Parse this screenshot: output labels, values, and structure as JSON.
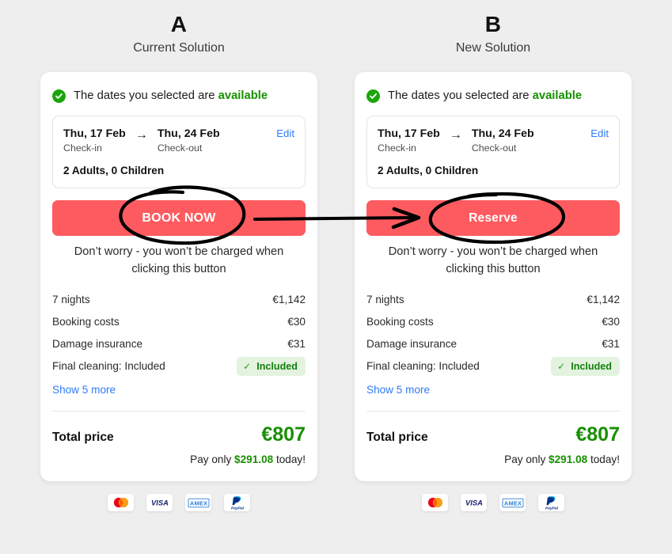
{
  "background_color": "#efeeee",
  "accent_colors": {
    "cta_red": "#fe5b60",
    "success_green": "#179000",
    "check_circle_green": "#1aa50b",
    "link_blue": "#2f7bf6",
    "badge_bg": "#e3f3df",
    "card_white": "#ffffff"
  },
  "panels": [
    {
      "letter": "A",
      "subtitle": "Current Solution",
      "availability": {
        "icon": "check-circle-icon",
        "text_prefix": "The dates you selected are ",
        "text_highlight": "available"
      },
      "dates": {
        "checkin_date": "Thu, 17 Feb",
        "checkin_label": "Check-in",
        "arrow": "→",
        "checkout_date": "Thu, 24 Feb",
        "checkout_label": "Check-out",
        "edit_label": "Edit",
        "guests": "2 Adults, 0 Children"
      },
      "cta_label": "BOOK NOW",
      "reassurance": "Don’t worry - you won’t be charged when clicking this button",
      "price_rows": [
        {
          "label": "7 nights",
          "value": "€1,142",
          "badge": null
        },
        {
          "label": "Booking costs",
          "value": "€30",
          "badge": null
        },
        {
          "label": "Damage insurance",
          "value": "€31",
          "badge": null
        },
        {
          "label": "Final cleaning: Included",
          "value": "",
          "badge": "Included"
        }
      ],
      "show_more_label": "Show 5 more",
      "total_label": "Total price",
      "total_value": "€807",
      "paynow_prefix": "Pay only ",
      "paynow_amount": "$291.08",
      "paynow_suffix": " today!",
      "payment_methods": [
        "mastercard-icon",
        "visa-icon",
        "amex-icon",
        "paypal-icon"
      ]
    },
    {
      "letter": "B",
      "subtitle": "New Solution",
      "availability": {
        "icon": "check-circle-icon",
        "text_prefix": "The dates you selected are ",
        "text_highlight": "available"
      },
      "dates": {
        "checkin_date": "Thu, 17 Feb",
        "checkin_label": "Check-in",
        "arrow": "→",
        "checkout_date": "Thu, 24 Feb",
        "checkout_label": "Check-out",
        "edit_label": "Edit",
        "guests": "2 Adults, 0 Children"
      },
      "cta_label": "Reserve",
      "reassurance": "Don’t worry - you won’t be charged when clicking this button",
      "price_rows": [
        {
          "label": "7 nights",
          "value": "€1,142",
          "badge": null
        },
        {
          "label": "Booking costs",
          "value": "€30",
          "badge": null
        },
        {
          "label": "Damage insurance",
          "value": "€31",
          "badge": null
        },
        {
          "label": "Final cleaning: Included",
          "value": "",
          "badge": "Included"
        }
      ],
      "show_more_label": "Show 5 more",
      "total_label": "Total price",
      "total_value": "€807",
      "paynow_prefix": "Pay only ",
      "paynow_amount": "$291.08",
      "paynow_suffix": " today!",
      "payment_methods": [
        "mastercard-icon",
        "visa-icon",
        "amex-icon",
        "paypal-icon"
      ]
    }
  ],
  "annotations": {
    "circle_a_target": "BOOK NOW",
    "circle_b_target": "Reserve",
    "arrow_direction": "left-to-right",
    "ink_color": "#000000"
  }
}
